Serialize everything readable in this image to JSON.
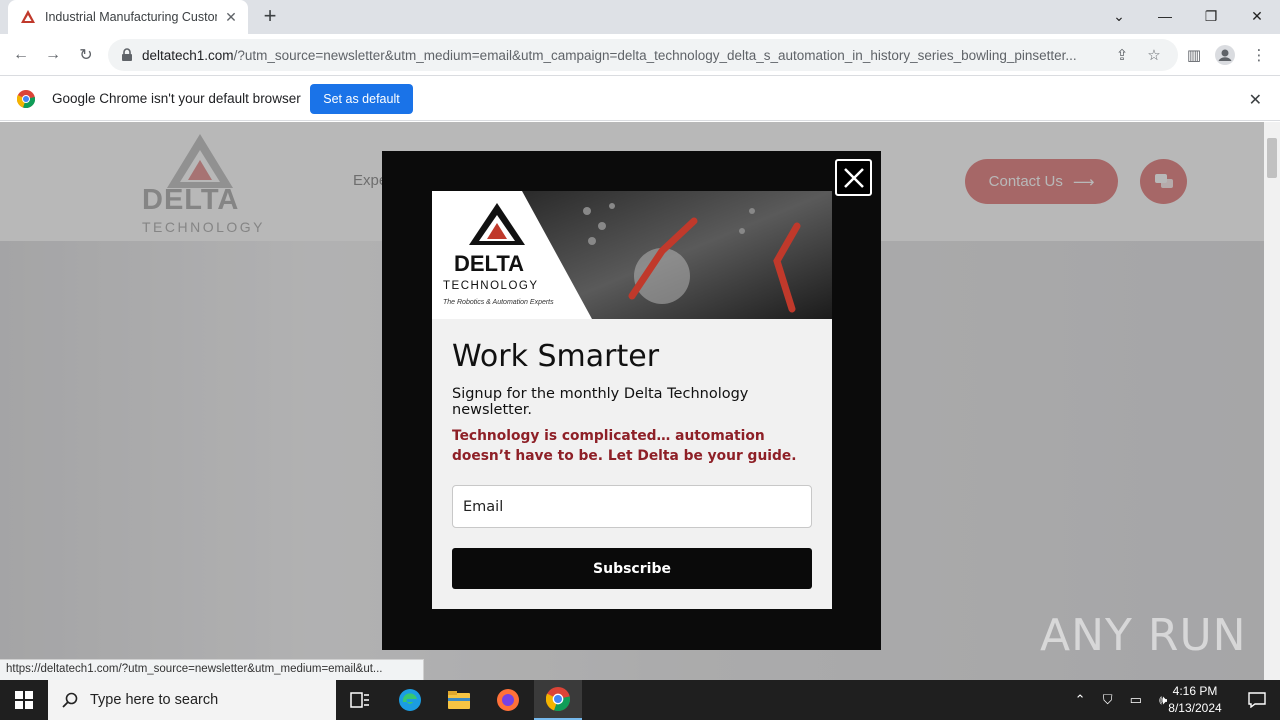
{
  "browser": {
    "tab_title": "Industrial Manufacturing Custom",
    "url_host": "deltatech1.com",
    "url_rest": "/?utm_source=newsletter&utm_medium=email&utm_campaign=delta_technology_delta_s_automation_in_history_series_bowling_pinsetter...",
    "infobar_message": "Google Chrome isn't your default browser",
    "infobar_button": "Set as default",
    "status_url": "https://deltatech1.com/?utm_source=newsletter&utm_medium=email&ut..."
  },
  "site": {
    "logo_line1": "DELTA",
    "logo_line2": "TECHNOLOGY",
    "nav_partial": "Expe",
    "contact_label": "Contact Us",
    "accent_color": "#e78f8f"
  },
  "modal": {
    "banner_logo_line1": "DELTA",
    "banner_logo_line2": "TECHNOLOGY",
    "banner_tagline": "The Robotics & Automation Experts",
    "title": "Work Smarter",
    "subtitle": "Signup for the monthly Delta Technology newsletter.",
    "highlight": "Technology is complicated… automation doesn’t have to be. Let Delta be your guide.",
    "email_placeholder": "Email",
    "subscribe_label": "Subscribe",
    "highlight_color": "#8e2027"
  },
  "watermark": "ANY RUN",
  "taskbar": {
    "search_placeholder": "Type here to search",
    "time": "4:16 PM",
    "date": "8/13/2024"
  }
}
